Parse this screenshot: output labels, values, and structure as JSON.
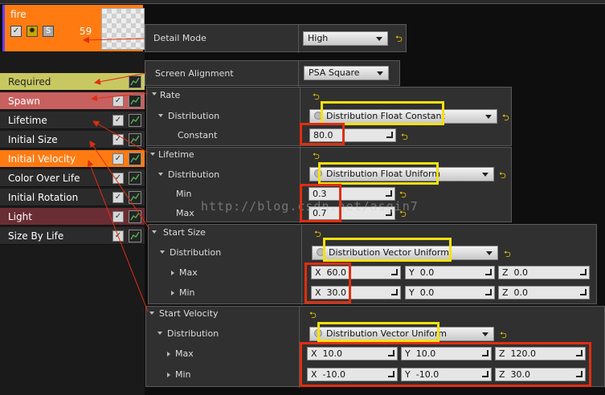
{
  "emitter": {
    "name": "fire",
    "count": "59",
    "badge_s": "S"
  },
  "modules": [
    {
      "label": "Required",
      "bg": "#c8c862",
      "fg": "#222222"
    },
    {
      "label": "Spawn",
      "bg": "#c96060",
      "fg": "#ffffff"
    },
    {
      "label": "Lifetime",
      "bg": "#2b2b2b",
      "fg": "#ffffff"
    },
    {
      "label": "Initial Size",
      "bg": "#2b2b2b",
      "fg": "#ffffff"
    },
    {
      "label": "Initial Velocity",
      "bg": "#ff7b12",
      "fg": "#ffffff"
    },
    {
      "label": "Color Over Life",
      "bg": "#2b2b2b",
      "fg": "#ffffff"
    },
    {
      "label": "Initial Rotation",
      "bg": "#2b2b2b",
      "fg": "#ffffff"
    },
    {
      "label": "Light",
      "bg": "#6a2d34",
      "fg": "#ffffff"
    },
    {
      "label": "Size By Life",
      "bg": "#2b2b2b",
      "fg": "#ffffff"
    }
  ],
  "detail": {
    "label": "Detail Mode",
    "value": "High"
  },
  "screen": {
    "label": "Screen Alignment",
    "value": "PSA Square"
  },
  "rate": {
    "header": "Rate",
    "dist_label": "Distribution",
    "dist_value": "Distribution Float Constant",
    "const_label": "Constant",
    "const_value": "80.0"
  },
  "lifetime": {
    "header": "Lifetime",
    "dist_label": "Distribution",
    "dist_value": "Distribution Float Uniform",
    "min_label": "Min",
    "min_value": "0.3",
    "max_label": "Max",
    "max_value": "0.7"
  },
  "start_size": {
    "header": "Start Size",
    "dist_label": "Distribution",
    "dist_value": "Distribution Vector Uniform",
    "max_label": "Max",
    "max": {
      "x": "60.0",
      "y": "0.0",
      "z": "0.0"
    },
    "min_label": "Min",
    "min": {
      "x": "30.0",
      "y": "0.0",
      "z": "0.0"
    }
  },
  "start_velocity": {
    "header": "Start Velocity",
    "dist_label": "Distribution",
    "dist_value": "Distribution Vector Uniform",
    "max_label": "Max",
    "max": {
      "x": "10.0",
      "y": "10.0",
      "z": "120.0"
    },
    "min_label": "Min",
    "min": {
      "x": "-10.0",
      "y": "-10.0",
      "z": "30.0"
    }
  },
  "axis": {
    "x": "X",
    "y": "Y",
    "z": "Z"
  },
  "watermark": "http://blog.csdn.net/asgin7",
  "colors": {
    "highlight_yellow": "#f5e10f",
    "highlight_red": "#e02e10",
    "reset_arrow": "#e8c800"
  }
}
